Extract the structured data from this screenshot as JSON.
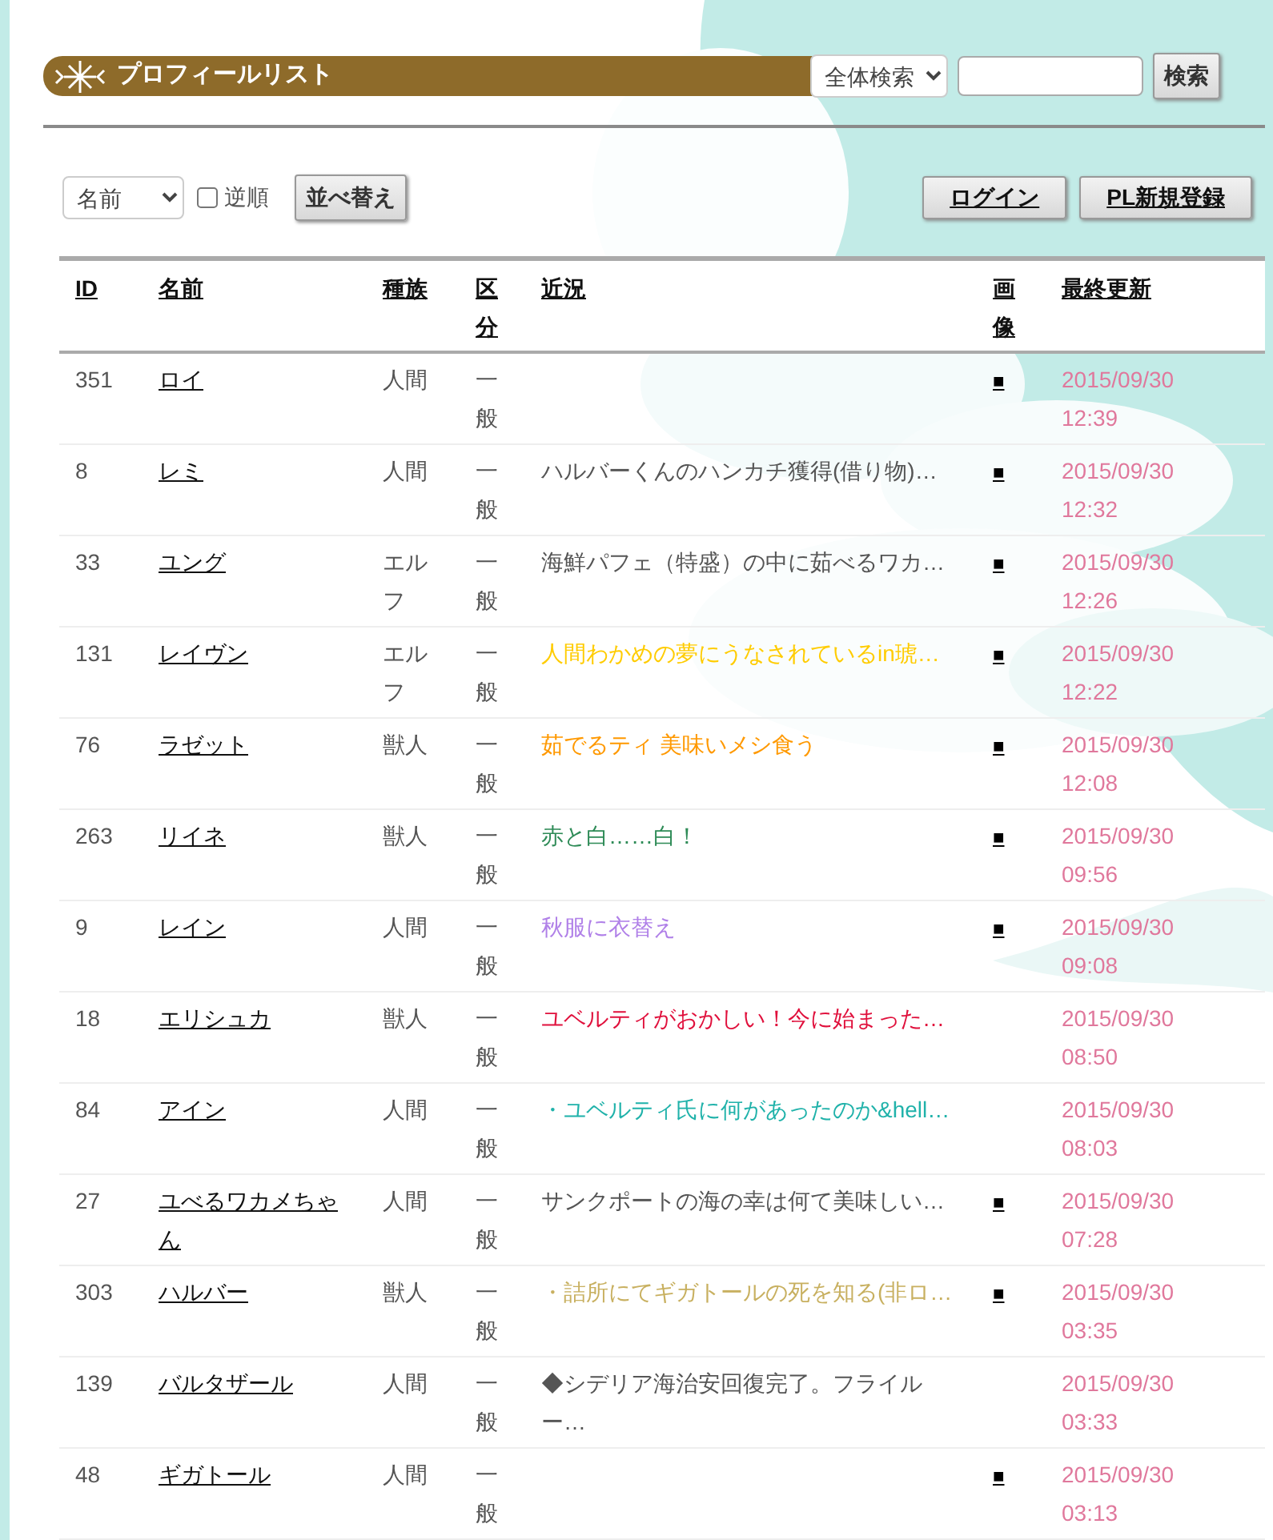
{
  "header": {
    "title": "プロフィールリスト",
    "search_scope": "全体検索",
    "search_button": "検索"
  },
  "sort": {
    "field": "名前",
    "reverse_label": "逆順",
    "reverse_checked": false,
    "sort_button": "並べ替え"
  },
  "account_buttons": [
    "ログイン",
    "PL新規登録"
  ],
  "table": {
    "columns": [
      "ID",
      "名前",
      "種族",
      "区分",
      "近況",
      "画像",
      "最終更新"
    ],
    "rows": [
      {
        "id": "351",
        "name": "ロイ",
        "race": "人間",
        "category": "一般",
        "image": "■",
        "updated": "2015/09/30 12:39"
      },
      {
        "id": "8",
        "name": "レミ",
        "race": "人間",
        "category": "一般",
        "status": "ハルバーくんのハンカチ獲得(借り物)…",
        "color": "#555555",
        "image": "■",
        "updated": "2015/09/30 12:32"
      },
      {
        "id": "33",
        "name": "ユング",
        "race": "エルフ",
        "category": "一般",
        "status": "海鮮パフェ（特盛）の中に茹べるワカ…",
        "color": "#555555",
        "image": "■",
        "updated": "2015/09/30 12:26"
      },
      {
        "id": "131",
        "name": "レイヴン",
        "race": "エルフ",
        "category": "一般",
        "status": "人間わかめの夢にうなされているin琥…",
        "color": "#ffcc00",
        "image": "■",
        "updated": "2015/09/30 12:22"
      },
      {
        "id": "76",
        "name": "ラゼット",
        "race": "獣人",
        "category": "一般",
        "status": "茹でるティ 美味いメシ食う",
        "color": "#ff9900",
        "image": "■",
        "updated": "2015/09/30 12:08"
      },
      {
        "id": "263",
        "name": "リイネ",
        "race": "獣人",
        "category": "一般",
        "status": "赤と白……白！",
        "color": "#2e8b57",
        "image": "■",
        "updated": "2015/09/30 09:56"
      },
      {
        "id": "9",
        "name": "レイン",
        "race": "人間",
        "category": "一般",
        "status": "秋服に衣替え",
        "color": "#b080e8",
        "image": "■",
        "updated": "2015/09/30 09:08"
      },
      {
        "id": "18",
        "name": "エリシュカ",
        "race": "獣人",
        "category": "一般",
        "status": "ユベルティがおかしい！今に始まった…",
        "color": "#e0103c",
        "updated": "2015/09/30 08:50"
      },
      {
        "id": "84",
        "name": "アイン",
        "race": "人間",
        "category": "一般",
        "status": "・ユベルティ氏に何があったのか&hell…",
        "color": "#20b2aa",
        "updated": "2015/09/30 08:03"
      },
      {
        "id": "27",
        "name": "ユべるワカメちゃん",
        "race": "人間",
        "category": "一般",
        "status": "サンクポートの海の幸は何て美味しい…",
        "color": "#555555",
        "image": "■",
        "updated": "2015/09/30 07:28"
      },
      {
        "id": "303",
        "name": "ハルバー",
        "race": "獣人",
        "category": "一般",
        "status": "・詰所にてギガトールの死を知る(非ロ…",
        "color": "#c8b060",
        "image": "■",
        "updated": "2015/09/30 03:35"
      },
      {
        "id": "139",
        "name": "バルタザール",
        "race": "人間",
        "category": "一般",
        "status": "◆シデリア海治安回復完了。フライルー…",
        "color": "#555555",
        "updated": "2015/09/30 03:33"
      },
      {
        "id": "48",
        "name": "ギガトール",
        "race": "人間",
        "category": "一般",
        "image": "■",
        "updated": "2015/09/30 03:13"
      }
    ]
  }
}
